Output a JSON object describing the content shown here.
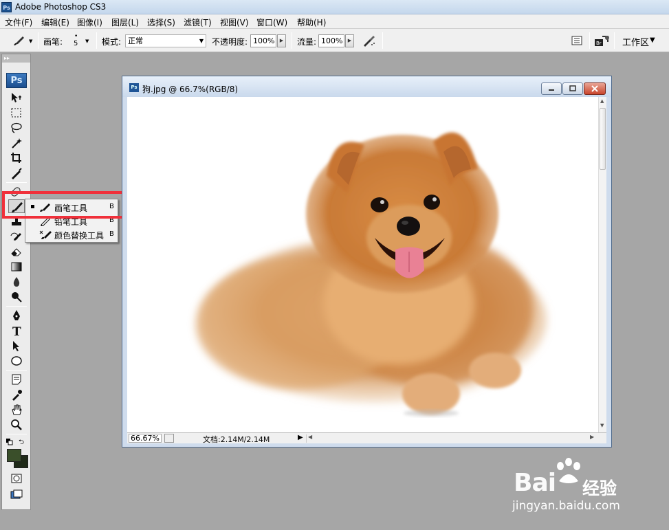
{
  "app": {
    "title": "Adobe Photoshop CS3",
    "logo": "Ps"
  },
  "menu": [
    "文件(F)",
    "编辑(E)",
    "图像(I)",
    "图层(L)",
    "选择(S)",
    "滤镜(T)",
    "视图(V)",
    "窗口(W)",
    "帮助(H)"
  ],
  "options": {
    "brush_label": "画笔:",
    "brush_size": "5",
    "mode_label": "模式:",
    "mode_value": "正常",
    "opacity_label": "不透明度:",
    "opacity_value": "100%",
    "flow_label": "流量:",
    "flow_value": "100%",
    "workspace_label": "工作区"
  },
  "toolbox": {
    "logo": "Ps"
  },
  "flyout": {
    "items": [
      {
        "label": "画笔工具",
        "key": "B"
      },
      {
        "label": "铅笔工具",
        "key": "B"
      },
      {
        "label": "颜色替换工具",
        "key": "B"
      }
    ]
  },
  "colors": {
    "foreground": "#3a4f2a",
    "background": "#1f2a18",
    "highlight": "#f0303a"
  },
  "document": {
    "title": "狗.jpg @ 66.7%(RGB/8)",
    "zoom": "66.67%",
    "doc_size": "文档:2.14M/2.14M"
  },
  "watermark": {
    "brand": "Bai",
    "brand2": "经验",
    "url": "jingyan.baidu.com"
  }
}
